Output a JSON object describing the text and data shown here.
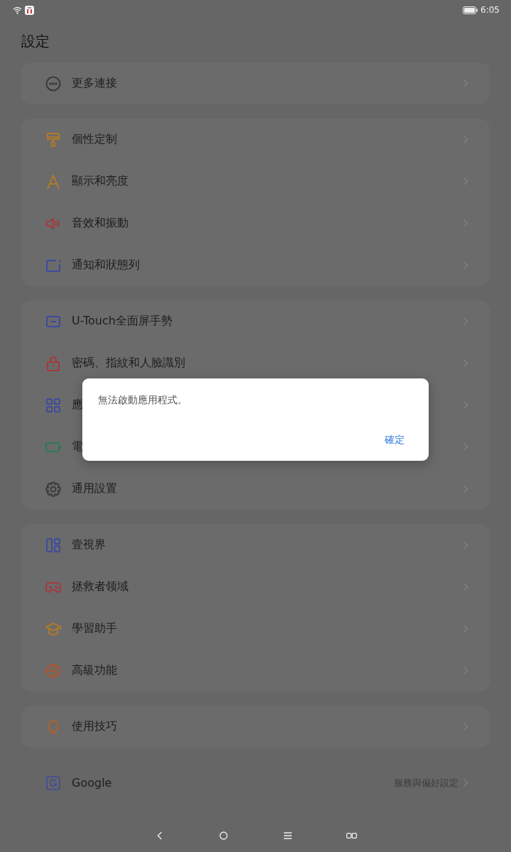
{
  "status_bar": {
    "time": "6:05"
  },
  "title": "設定",
  "groups": [
    {
      "items": [
        {
          "label": "更多連接",
          "color": "#3a3a3a"
        }
      ]
    },
    {
      "items": [
        {
          "label": "個性定制",
          "color": "#b07a2a"
        },
        {
          "label": "顯示和亮度",
          "color": "#b07a2a"
        },
        {
          "label": "音效和振動",
          "color": "#a8383c"
        },
        {
          "label": "通知和狀態列",
          "color": "#3d4b9e"
        }
      ]
    },
    {
      "items": [
        {
          "label": "U-Touch全面屏手勢",
          "color": "#3d4b9e"
        },
        {
          "label": "密碼、指紋和人臉識別",
          "color": "#a8383c"
        },
        {
          "label": "應",
          "color": "#3d4b9e"
        },
        {
          "label": "電",
          "color": "#2e7a52"
        },
        {
          "label": "通用設置",
          "color": "#3a3a3a"
        }
      ]
    },
    {
      "items": [
        {
          "label": "壹視界",
          "color": "#3d4b9e"
        },
        {
          "label": "拯救者领域",
          "color": "#a8383c"
        },
        {
          "label": "學習助手",
          "color": "#b07a2a"
        },
        {
          "label": "高級功能",
          "color": "#b0552e"
        }
      ]
    },
    {
      "items": [
        {
          "label": "使用技巧",
          "color": "#b0602e"
        }
      ]
    }
  ],
  "google_row": {
    "label": "Google",
    "value": "服務與偏好設定",
    "color": "#3d4b9e"
  },
  "dialog": {
    "message": "無法啟動應用程式。",
    "button": "確定"
  }
}
